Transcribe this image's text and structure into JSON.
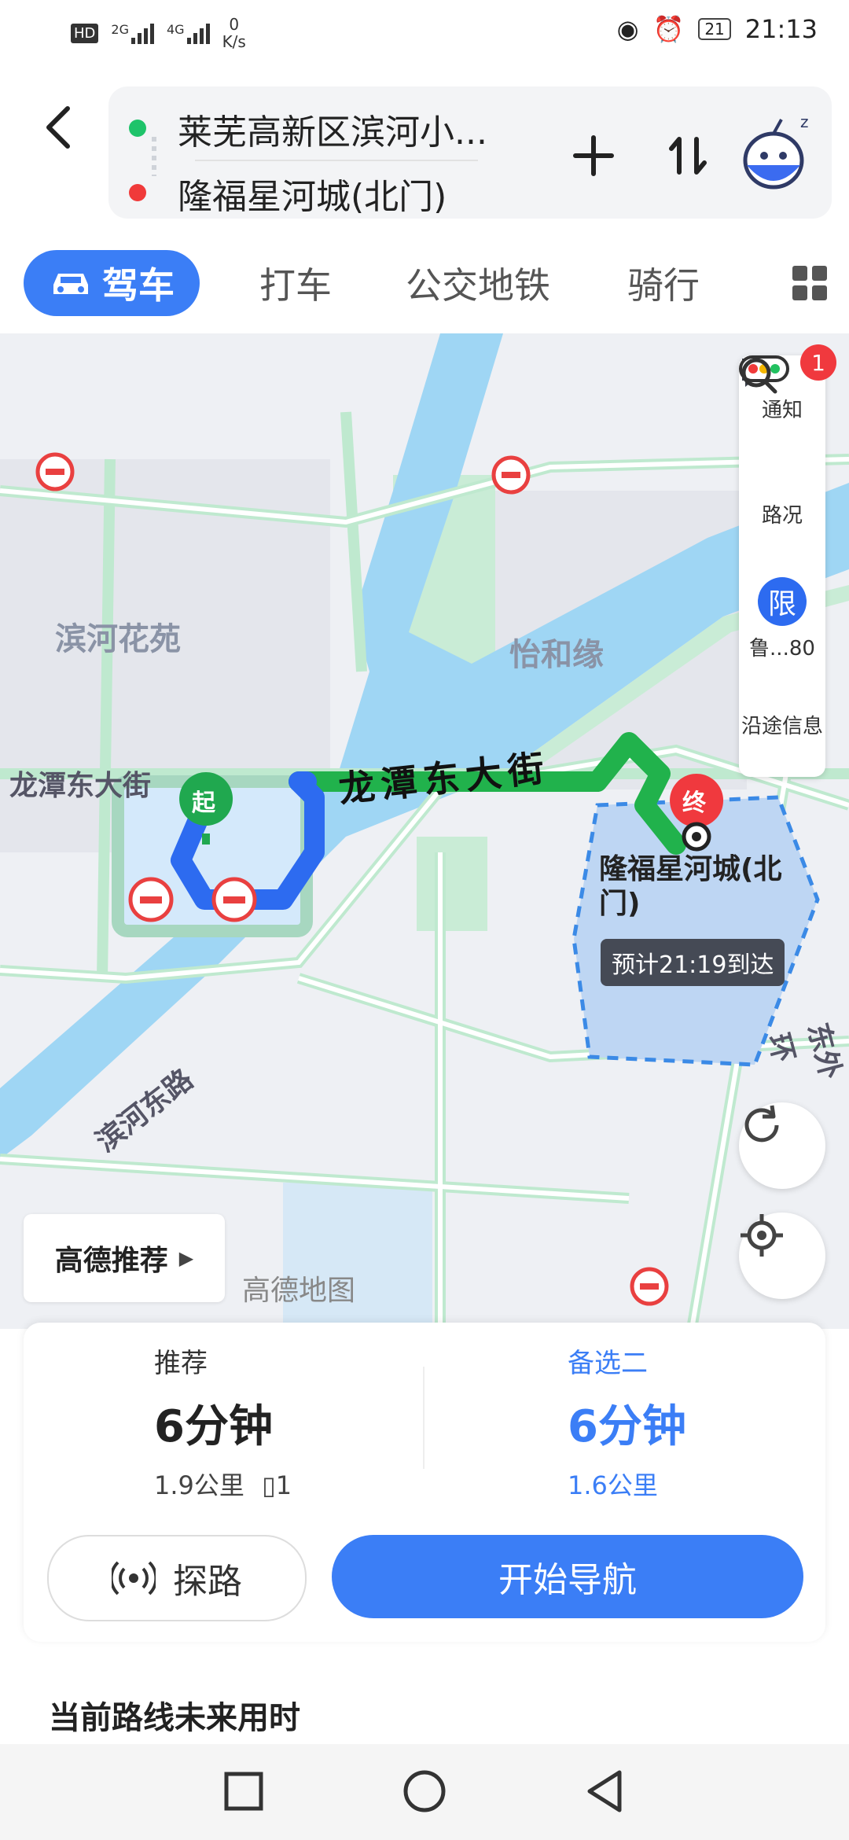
{
  "status_bar": {
    "network_left": "HD",
    "net1": "2G",
    "net2": "4G",
    "speed_value": "0",
    "speed_unit": "K/s",
    "battery": "21",
    "time": "21:13"
  },
  "header": {
    "start": "莱芜高新区滨河小...",
    "end": "隆福星河城(北门)",
    "add_icon": "plus-icon",
    "swap_icon": "swap-icon"
  },
  "tabs": [
    {
      "label": "驾车",
      "active": true
    },
    {
      "label": "打车"
    },
    {
      "label": "公交地铁"
    },
    {
      "label": "骑行"
    }
  ],
  "map": {
    "labels": {
      "area1": "滨河花苑",
      "area2": "怡和缘",
      "road1": "龙潭东大街",
      "road_main": "龙潭东大街",
      "road2": "滨河东路",
      "road3": "东外环"
    },
    "start_marker": "起",
    "end_marker": "终",
    "destination": "隆福星河城(北门)",
    "eta": "预计21:19到达",
    "logo": "高德地图",
    "rail": {
      "notice": "通知",
      "notice_badge": "1",
      "traffic": "路况",
      "restrict_icon": "限",
      "restrict": "鲁...80",
      "along": "沿途信息"
    },
    "recommend": "高德推荐"
  },
  "routes": {
    "opt1": {
      "label": "推荐",
      "duration": "6分钟",
      "distance": "1.9公里",
      "lights": "1"
    },
    "opt2": {
      "label": "备选二",
      "duration": "6分钟",
      "distance": "1.6公里"
    }
  },
  "actions": {
    "probe": "探路",
    "start": "开始导航"
  },
  "future": "当前路线未来用时"
}
